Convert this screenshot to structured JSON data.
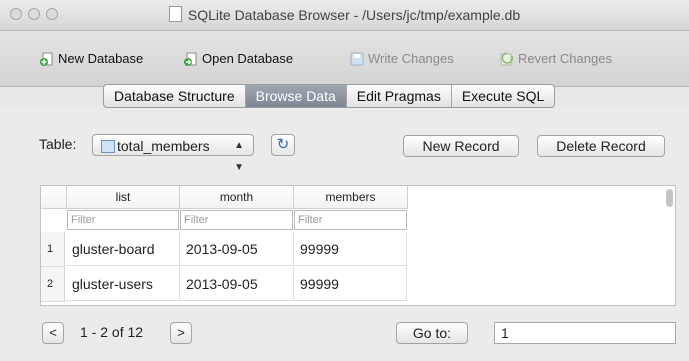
{
  "window": {
    "title": "SQLite Database Browser - /Users/jc/tmp/example.db"
  },
  "toolbar": {
    "new_database": "New Database",
    "open_database": "Open Database",
    "write_changes": "Write Changes",
    "revert_changes": "Revert Changes"
  },
  "tabs": [
    {
      "label": "Database Structure"
    },
    {
      "label": "Browse Data"
    },
    {
      "label": "Edit Pragmas"
    },
    {
      "label": "Execute SQL"
    }
  ],
  "browse": {
    "table_label": "Table:",
    "table_selected": "total_members",
    "new_record": "New Record",
    "delete_record": "Delete Record"
  },
  "grid": {
    "columns": [
      "list",
      "month",
      "members"
    ],
    "filter_placeholder": "Filter",
    "rows": [
      {
        "num": "1",
        "cells": [
          "gluster-board",
          "2013-09-05",
          "99999"
        ]
      },
      {
        "num": "2",
        "cells": [
          "gluster-users",
          "2013-09-05",
          "99999"
        ]
      }
    ]
  },
  "pager": {
    "prev": "<",
    "range": "1 - 2 of 12",
    "next": ">",
    "goto_label": "Go to:",
    "goto_value": "1"
  },
  "icons": {
    "refresh": "refresh-icon",
    "table": "table-icon",
    "document": "document-icon"
  },
  "colors": {
    "active_tab": "#8a929e",
    "accent": "#2d6db4"
  }
}
